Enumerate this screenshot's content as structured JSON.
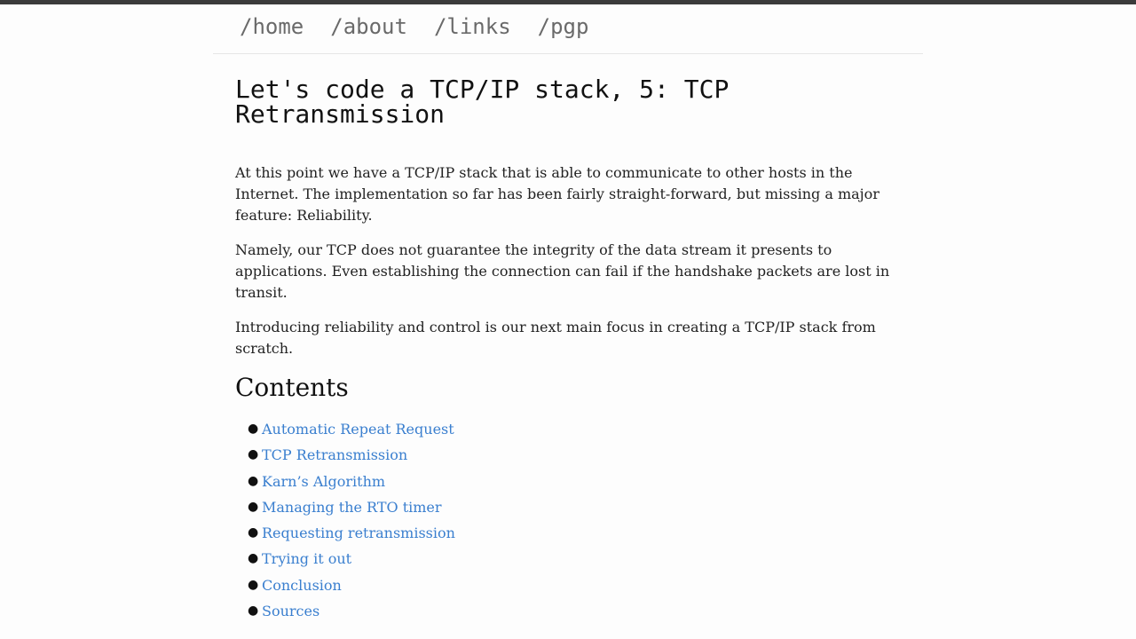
{
  "nav": {
    "items": [
      {
        "label": "/home"
      },
      {
        "label": "/about"
      },
      {
        "label": "/links"
      },
      {
        "label": "/pgp"
      }
    ]
  },
  "post": {
    "title": "Let's code a TCP/IP stack, 5: TCP Retransmission",
    "paragraphs": [
      "At this point we have a TCP/IP stack that is able to communicate to other hosts in the Internet. The implementation so far has been fairly straight-forward, but missing a major feature: Reliability.",
      "Namely, our TCP does not guarantee the integrity of the data stream it presents to applications. Even establishing the connection can fail if the handshake packets are lost in transit.",
      "Introducing reliability and control is our next main focus in creating a TCP/IP stack from scratch."
    ],
    "contents_heading": "Contents",
    "contents": [
      {
        "label": "Automatic Repeat Request"
      },
      {
        "label": "TCP Retransmission"
      },
      {
        "label": "Karn’s Algorithm"
      },
      {
        "label": "Managing the RTO timer"
      },
      {
        "label": "Requesting retransmission"
      },
      {
        "label": "Trying it out"
      },
      {
        "label": "Conclusion"
      },
      {
        "label": "Sources"
      }
    ]
  },
  "colors": {
    "link": "#3a7fcf",
    "nav": "#6a6a6a",
    "top_bar": "#3b3b3b"
  }
}
